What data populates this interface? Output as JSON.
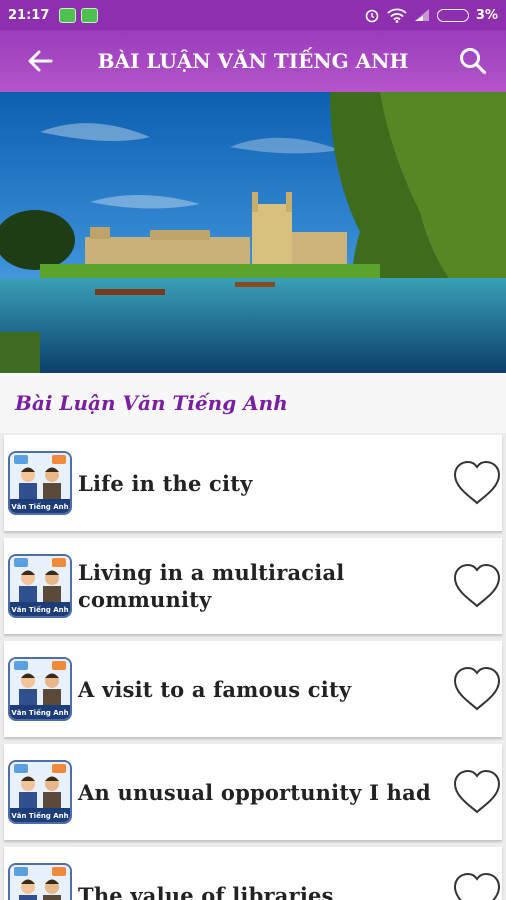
{
  "status_bar": {
    "time": "21:17",
    "battery": "3%"
  },
  "app_bar": {
    "title": "BÀI LUẬN VĂN TIẾNG ANH",
    "back_icon": "arrow-back-icon",
    "search_icon": "search-icon"
  },
  "section": {
    "title": "Bài Luận Văn Tiếng Anh"
  },
  "thumb": {
    "caption": "Văn Tiếng Anh"
  },
  "items": [
    {
      "title": "Life in the city"
    },
    {
      "title": "Living in a multiracial community"
    },
    {
      "title": "A visit to a famous city"
    },
    {
      "title": "An unusual opportunity I had"
    },
    {
      "title": "The value of libraries"
    }
  ],
  "colors": {
    "primary": "#9a3cbc",
    "accent_text": "#7b1fa2"
  }
}
